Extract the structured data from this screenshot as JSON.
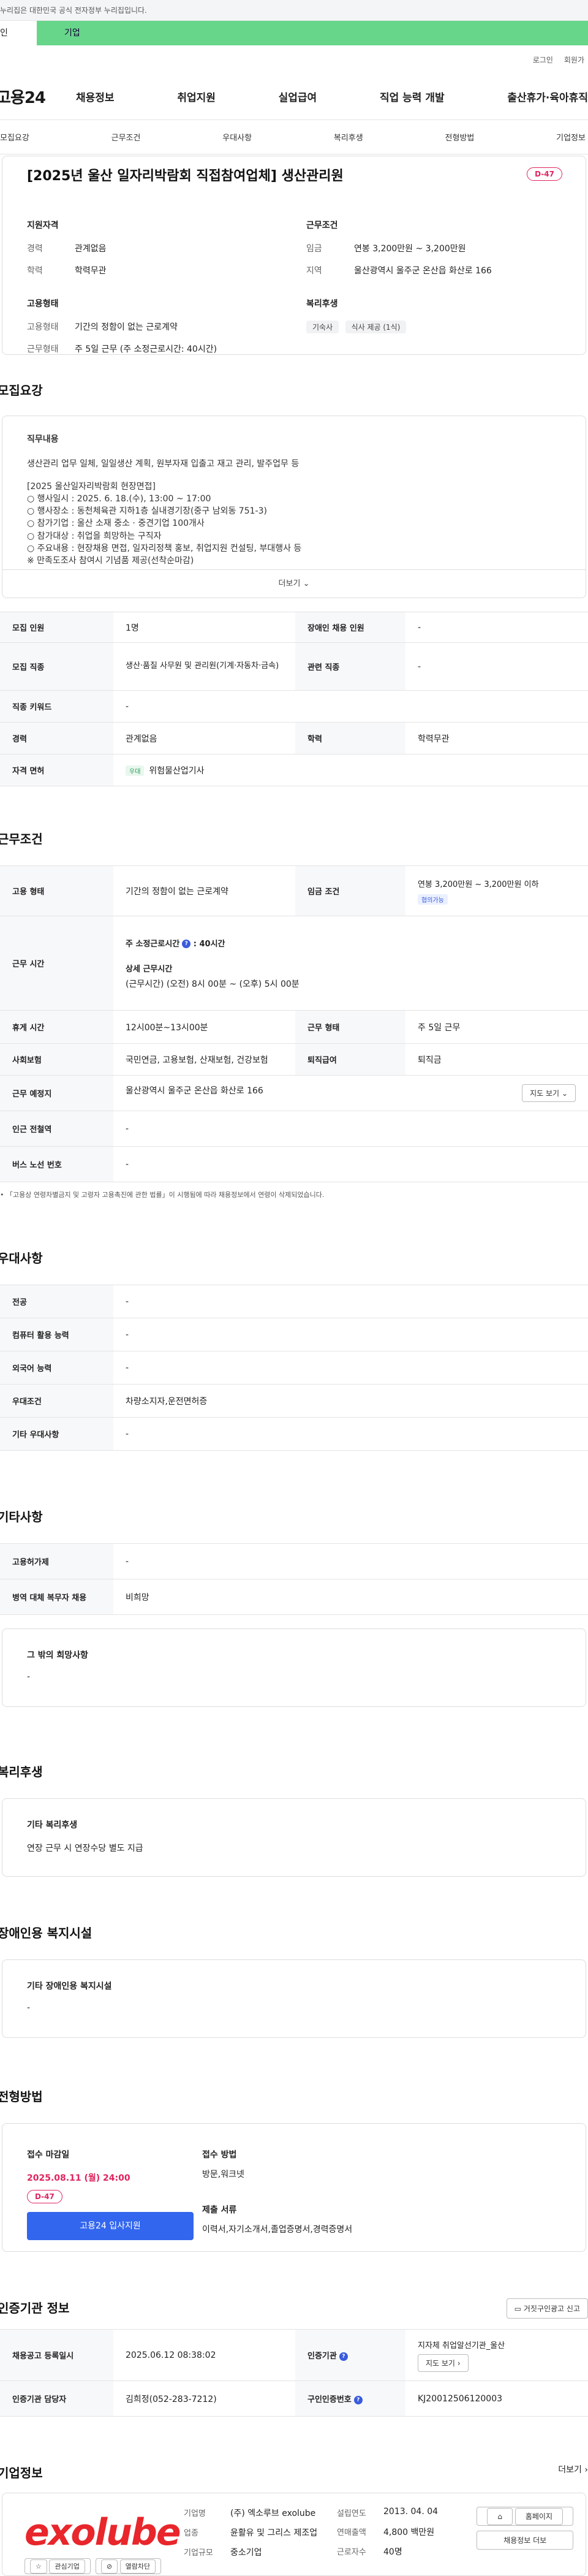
{
  "gov_banner": "누리집은 대한민국 공식 전자정부 누리집입니다.",
  "tabs": {
    "personal": "인",
    "company": "기업"
  },
  "util": {
    "login": "로그인",
    "join": "회원가"
  },
  "logo": "고용24",
  "gnb": [
    "채용정보",
    "취업지원",
    "실업급여",
    "직업 능력 개발",
    "출산휴가·육아휴직"
  ],
  "subnav": [
    "모집요강",
    "근무조건",
    "우대사항",
    "복리후생",
    "전형방법",
    "기업정보"
  ],
  "hero": {
    "title": "[2025년 울산 일자리박람회 직접참여업체] 생산관리원",
    "dday": "D-47",
    "qual_title": "지원자격",
    "career_k": "경력",
    "career_v": "관계없음",
    "edu_k": "학력",
    "edu_v": "학력무관",
    "cond_title": "근무조건",
    "wage_k": "임금",
    "wage_v": "연봉 3,200만원 ~ 3,200만원",
    "region_k": "지역",
    "region_v": "울산광역시 울주군 온산읍 화산로 166",
    "emp_title": "고용형태",
    "emptype_k": "고용형태",
    "emptype_v": "기간의 정함이 없는 근로계약",
    "worktype_k": "근무형태",
    "worktype_v": "주 5일 근무 (주 소정근로시간: 40시간)",
    "welfare_title": "복리후생",
    "welfare_chips": [
      "기숙사",
      "식사 제공 (1식)"
    ]
  },
  "recruit": {
    "title": "모집요강",
    "duty_title": "직무내용",
    "duty_lines": [
      "생산관리 업무 일체, 일일생산 계획, 원부자재 입출고 재고 관리, 발주업무 등",
      "",
      "[2025 울산일자리박람회 현장면접]",
      "○ 행사일시 : 2025. 6. 18.(수), 13:00 ~ 17:00",
      "○ 행사장소 : 동천체육관 지하1층 실내경기장(중구 남외동 751-3)",
      "○ 참가기업 : 울산 소재 중소 · 중견기업 100개사",
      "○ 참가대상 : 취업을 희망하는 구직자",
      "○ 주요내용 : 현장채용 면접, 일자리정책 홍보, 취업지원 컨설팅, 부대행사 등",
      "※ 만족도조사 참여시 기념품 제공(선착순마감)"
    ],
    "more": "더보기",
    "rows": {
      "count_k": "모집 인원",
      "count_v": "1명",
      "disabled_k": "장애인 채용 인원",
      "disabled_v": "-",
      "job_k": "모집 직종",
      "job_v": "생산·품질 사무원 및 관리원(기계·자동차·금속)",
      "related_k": "관련 직종",
      "related_v": "-",
      "keyword_k": "직종 키워드",
      "keyword_v": "-",
      "career_k": "경력",
      "career_v": "관계없음",
      "edu_k": "학력",
      "edu_v": "학력무관",
      "license_k": "자격 면허",
      "license_tag": "우대",
      "license_v": "위험물산업기사"
    }
  },
  "work": {
    "title": "근무조건",
    "emp_k": "고용 형태",
    "emp_v": "기간의 정함이 없는 근로계약",
    "wage_k": "임금 조건",
    "wage_v": "연봉 3,200만원 ~ 3,200만원 이하",
    "wage_tag": "협의가능",
    "hours_k": "근무 시간",
    "hours_week": "주 소정근로시간",
    "hours_week_v": ": 40시간",
    "hours_detail_title": "상세 근무시간",
    "hours_detail_v": "(근무시간) (오전) 8시 00분 ~ (오후) 5시 00분",
    "break_k": "휴게 시간",
    "break_v": "12시00분~13시00분",
    "form_k": "근무 형태",
    "form_v": "주 5일 근무",
    "insure_k": "사회보험",
    "insure_v": "국민연금, 고용보험, 산재보험, 건강보험",
    "retire_k": "퇴직급여",
    "retire_v": "퇴직금",
    "place_k": "근무 예정지",
    "place_v": "울산광역시 울주군 온산읍 화산로 166",
    "map_btn": "지도 보기",
    "subway_k": "인근 전철역",
    "subway_v": "-",
    "bus_k": "버스 노선 번호",
    "bus_v": "-",
    "note": "• 「고용상 연령차별금지 및 고령자 고용촉진에 관한 법률」이 시행됨에 따라 채용정보에서 연령이 삭제되었습니다."
  },
  "pref": {
    "title": "우대사항",
    "major_k": "전공",
    "major_v": "-",
    "computer_k": "컴퓨터 활용 능력",
    "computer_v": "-",
    "lang_k": "외국어 능력",
    "lang_v": "-",
    "cond_k": "우대조건",
    "cond_v": "차량소지자,운전면허증",
    "etc_k": "기타 우대사항",
    "etc_v": "-"
  },
  "other": {
    "title": "기타사항",
    "hire_k": "고용허가제",
    "hire_v": "-",
    "mil_k": "병역 대체 복무자 채용",
    "mil_v": "비희망",
    "hope_title": "그 밖의 희망사항",
    "hope_v": "-"
  },
  "benefit": {
    "title": "복리후생",
    "box_title": "기타 복리후생",
    "box_v": "연장 근무 시 연장수당 별도 지급"
  },
  "disable": {
    "title": "장애인용 복지시설",
    "box_title": "기타 장애인용 복지시설",
    "box_v": "-"
  },
  "apply": {
    "title": "전형방법",
    "deadline_title": "접수 마감일",
    "deadline_v": "2025.08.11 (월) 24:00",
    "dday": "D-47",
    "btn": "고용24 입사지원",
    "method_title": "접수 방법",
    "method_v": "방문,워크넷",
    "docs_title": "제출 서류",
    "docs_v": "이력서,자기소개서,졸업증명서,경력증명서"
  },
  "agency": {
    "title": "인증기관 정보",
    "report": "거짓구인광고 신고",
    "reg_k": "채용공고 등록일시",
    "reg_v": "2025.06.12 08:38:02",
    "org_k": "인증기관",
    "org_v": "지자체 취업알선기관_울산",
    "org_btn": "지도 보기",
    "person_k": "인증기관 담당자",
    "person_v": "김희정(052-283-7212)",
    "num_k": "구인인증번호",
    "num_v": "KJ20012506120003"
  },
  "corp": {
    "title": "기업정보",
    "more": "더보기",
    "logo_text": "exolube",
    "fav": "관심기업",
    "block": "열람차단",
    "name_k": "기업명",
    "name_v": "(주) 엑소루브 exolube",
    "industry_k": "업종",
    "industry_v": "윤활유 및 그리스 제조업",
    "size_k": "기업규모",
    "size_v": "중소기업",
    "est_k": "설립연도",
    "est_v": "2013. 04. 04",
    "sales_k": "연매출액",
    "sales_v": "4,800 백만원",
    "emp_k": "근로자수",
    "emp_v": "40명",
    "home_btn": "홈페이지",
    "jobs_btn": "채용정보 더보"
  }
}
